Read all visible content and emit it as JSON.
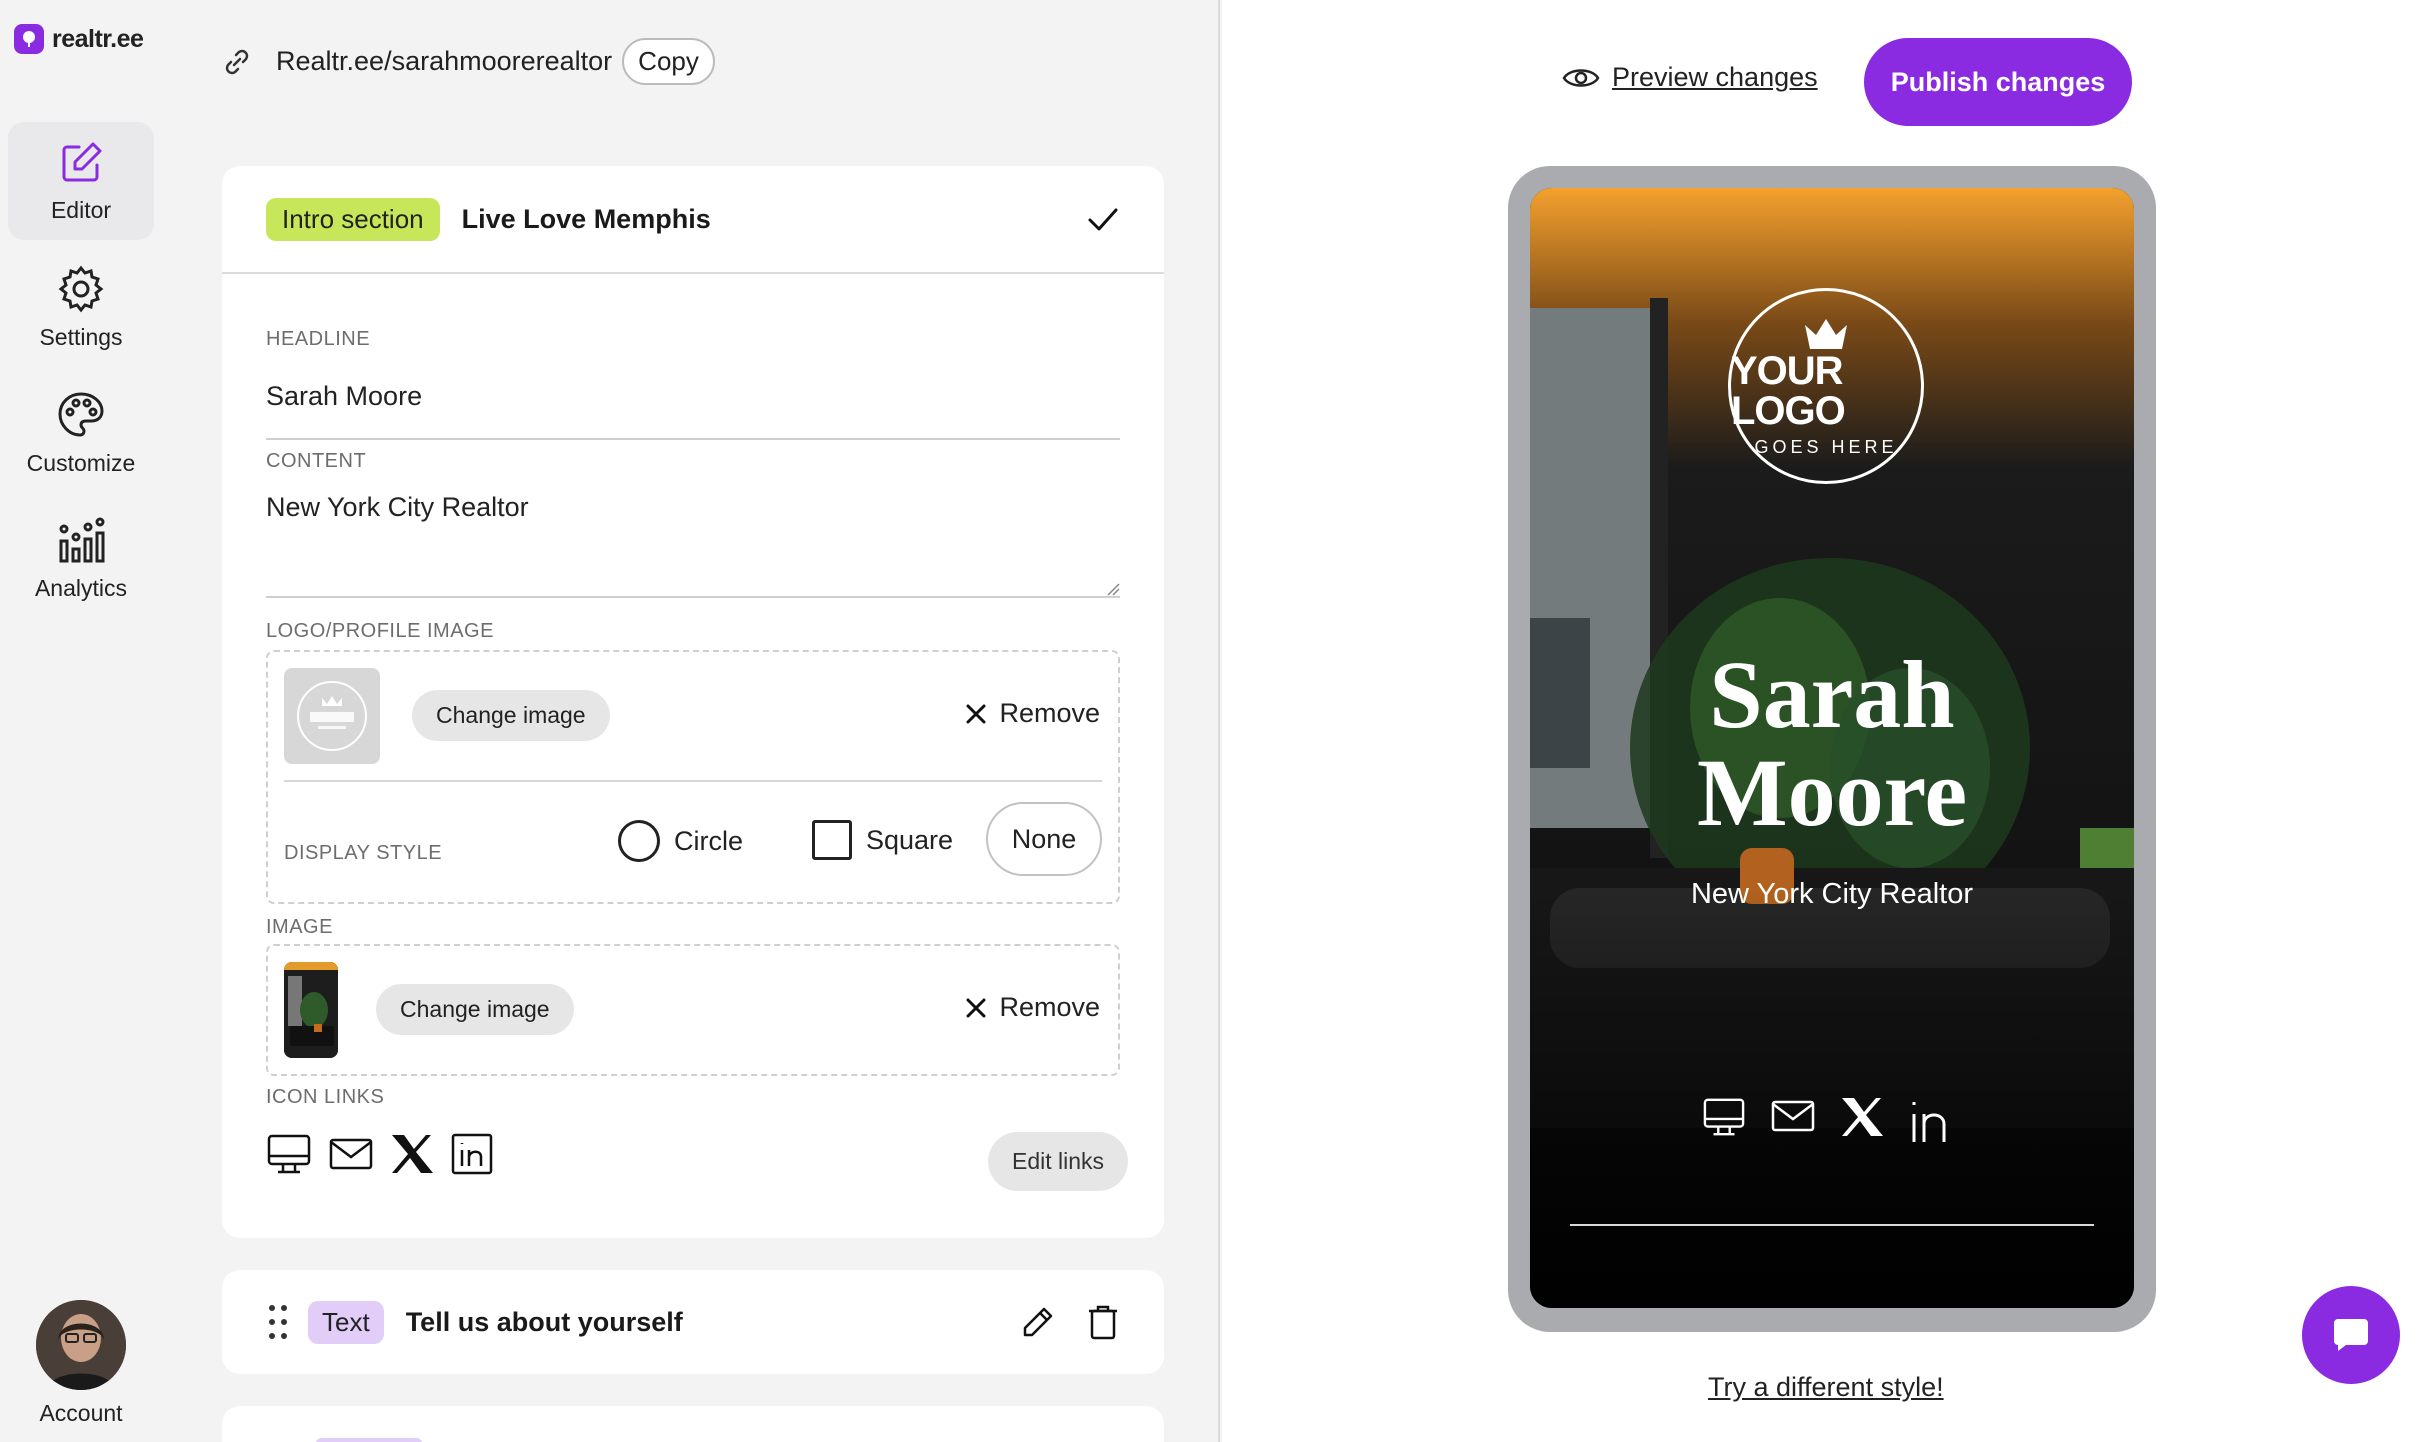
{
  "brand": {
    "name": "realtr.ee",
    "accent": "#8a2be2"
  },
  "nav": {
    "items": [
      {
        "label": "Editor",
        "icon": "edit-icon",
        "active": true
      },
      {
        "label": "Settings",
        "icon": "gear-icon"
      },
      {
        "label": "Customize",
        "icon": "palette-icon"
      },
      {
        "label": "Analytics",
        "icon": "analytics-icon"
      }
    ],
    "account_label": "Account"
  },
  "url": {
    "text": "Realtr.ee/sarahmoorerealtor",
    "copy_label": "Copy"
  },
  "intro": {
    "tag": "Intro section",
    "title": "Live Love Memphis",
    "headline_label": "HEADLINE",
    "headline_value": "Sarah Moore",
    "content_label": "CONTENT",
    "content_value": "New York City Realtor",
    "logo_label": "LOGO/PROFILE IMAGE",
    "change_image_label": "Change image",
    "remove_label": "Remove",
    "display_style_label": "DISPLAY STYLE",
    "style_options": {
      "circle": "Circle",
      "square": "Square",
      "none": "None"
    },
    "image_label": "IMAGE",
    "icon_links_label": "ICON LINKS",
    "icon_links": [
      "monitor-icon",
      "mail-icon",
      "x-icon",
      "linkedin-icon"
    ],
    "edit_links_label": "Edit links"
  },
  "text_section": {
    "tag": "Text",
    "title": "Tell us about yourself"
  },
  "preview": {
    "preview_label": "Preview changes",
    "publish_label": "Publish changes",
    "logo_main": "YOUR LOGO",
    "logo_sub": "GOES HERE",
    "name_line1": "Sarah",
    "name_line2": "Moore",
    "subtitle": "New York City Realtor",
    "try_label": "Try a different style!"
  },
  "colors": {
    "green_tag": "#c8e65a",
    "purple_tag": "#e2cdf9",
    "publish": "#8a2be2"
  }
}
